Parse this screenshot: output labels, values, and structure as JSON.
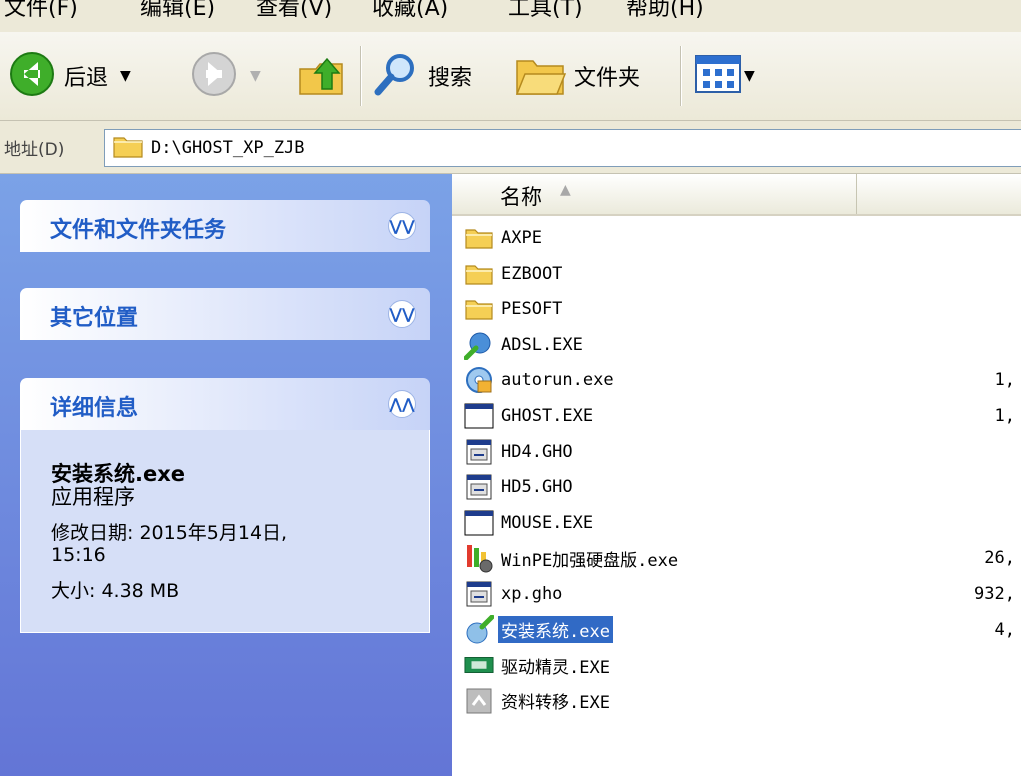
{
  "menu": [
    "文件(F)",
    "编辑(E)",
    "查看(V)",
    "收藏(A)",
    "工具(T)",
    "帮助(H)"
  ],
  "toolbar": {
    "back_label": "后退",
    "search_label": "搜索",
    "folders_label": "文件夹"
  },
  "address": {
    "label": "地址(D)",
    "path": "D:\\GHOST_XP_ZJB"
  },
  "taskpane": {
    "tasks_title": "文件和文件夹任务",
    "other_title": "其它位置",
    "details_title": "详细信息",
    "details": {
      "name": "安装系统.exe",
      "type": "应用程序",
      "modified": "修改日期: 2015年5月14日,",
      "modified_time": "15:16",
      "size": "大小: 4.38 MB"
    }
  },
  "filelist": {
    "col_name": "名称",
    "files": [
      {
        "name": "AXPE",
        "icon": "folder",
        "size": ""
      },
      {
        "name": "EZBOOT",
        "icon": "folder",
        "size": ""
      },
      {
        "name": "PESOFT",
        "icon": "folder",
        "size": ""
      },
      {
        "name": "ADSL.EXE",
        "icon": "network-app",
        "size": ""
      },
      {
        "name": "autorun.exe",
        "icon": "autorun-app",
        "size": "1,"
      },
      {
        "name": "GHOST.EXE",
        "icon": "dos-window",
        "size": "1,"
      },
      {
        "name": "HD4.GHO",
        "icon": "gho-file",
        "size": ""
      },
      {
        "name": "HD5.GHO",
        "icon": "gho-file",
        "size": ""
      },
      {
        "name": "MOUSE.EXE",
        "icon": "dos-window",
        "size": ""
      },
      {
        "name": "WinPE加强硬盘版.exe",
        "icon": "installer",
        "size": "26,"
      },
      {
        "name": "xp.gho",
        "icon": "gho-file",
        "size": "932,"
      },
      {
        "name": "安装系统.exe",
        "icon": "setup-app",
        "size": "4,",
        "selected": true
      },
      {
        "name": "驱动精灵.EXE",
        "icon": "driver-app",
        "size": ""
      },
      {
        "name": "资料转移.EXE",
        "icon": "transfer-app",
        "size": ""
      }
    ]
  },
  "colors": {
    "selection": "#316ac5",
    "pane_top": "#7ba2e7",
    "pane_bottom": "#6375d6",
    "panel_title": "#215dc6"
  }
}
